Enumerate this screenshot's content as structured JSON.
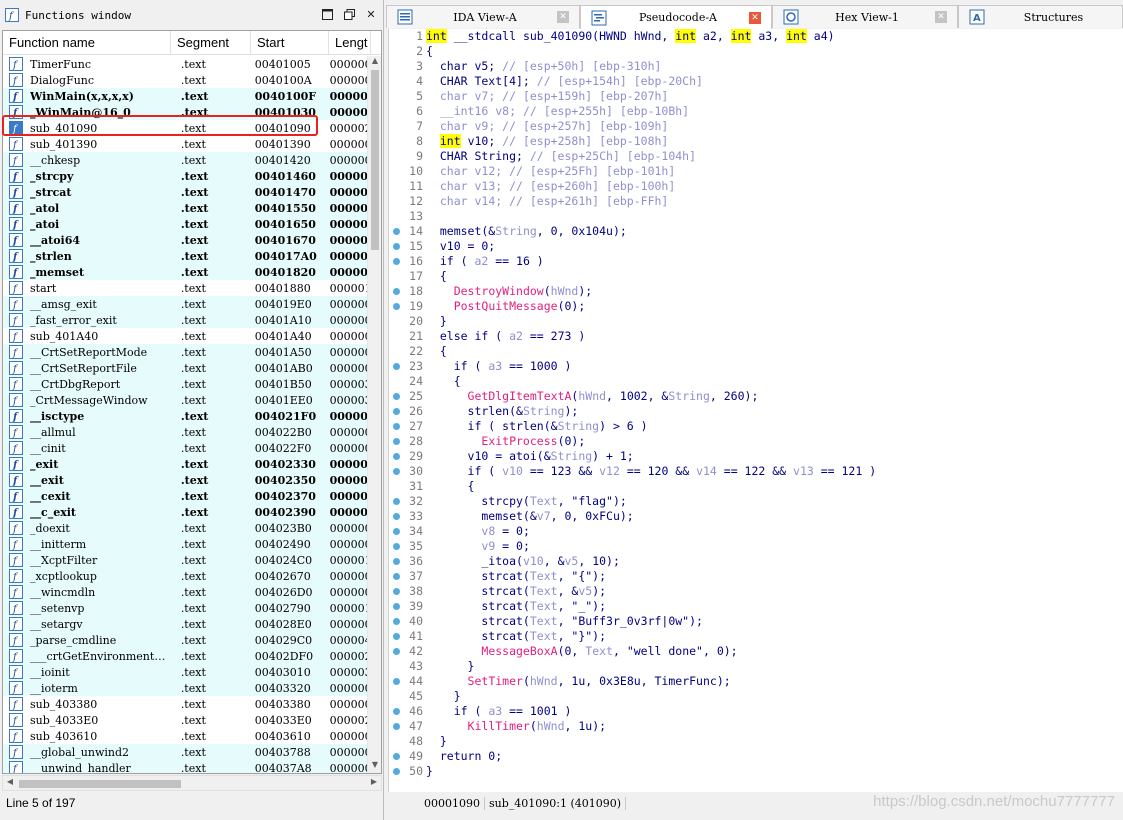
{
  "functions_window": {
    "title": "Functions window",
    "columns": [
      "Function name",
      "Segment",
      "Start",
      "Lengt"
    ],
    "status": "Line 5 of 197",
    "rows": [
      {
        "name": "TimerFunc",
        "seg": ".text",
        "start": "00401005",
        "len": "000000",
        "hl": false,
        "bold": false
      },
      {
        "name": "DialogFunc",
        "seg": ".text",
        "start": "0040100A",
        "len": "000000",
        "hl": false,
        "bold": false
      },
      {
        "name": "WinMain(x,x,x,x)",
        "seg": ".text",
        "start": "0040100F",
        "len": "000000",
        "hl": true,
        "bold": true
      },
      {
        "name": "_WinMain@16_0",
        "seg": ".text",
        "start": "00401030",
        "len": "000000",
        "hl": true,
        "bold": true
      },
      {
        "name": "sub_401090",
        "seg": ".text",
        "start": "00401090",
        "len": "000002",
        "hl": false,
        "bold": false
      },
      {
        "name": "sub_401390",
        "seg": ".text",
        "start": "00401390",
        "len": "000000",
        "hl": false,
        "bold": false
      },
      {
        "name": "__chkesp",
        "seg": ".text",
        "start": "00401420",
        "len": "000000",
        "hl": true,
        "bold": false
      },
      {
        "name": "_strcpy",
        "seg": ".text",
        "start": "00401460",
        "len": "000000",
        "hl": true,
        "bold": true
      },
      {
        "name": "_strcat",
        "seg": ".text",
        "start": "00401470",
        "len": "000000",
        "hl": true,
        "bold": true
      },
      {
        "name": "_atol",
        "seg": ".text",
        "start": "00401550",
        "len": "000000",
        "hl": true,
        "bold": true
      },
      {
        "name": "_atoi",
        "seg": ".text",
        "start": "00401650",
        "len": "000000",
        "hl": true,
        "bold": true
      },
      {
        "name": "__atoi64",
        "seg": ".text",
        "start": "00401670",
        "len": "000000",
        "hl": true,
        "bold": true
      },
      {
        "name": "_strlen",
        "seg": ".text",
        "start": "004017A0",
        "len": "000000",
        "hl": true,
        "bold": true
      },
      {
        "name": "_memset",
        "seg": ".text",
        "start": "00401820",
        "len": "000000",
        "hl": true,
        "bold": true
      },
      {
        "name": "start",
        "seg": ".text",
        "start": "00401880",
        "len": "000001",
        "hl": false,
        "bold": false
      },
      {
        "name": "__amsg_exit",
        "seg": ".text",
        "start": "004019E0",
        "len": "000000",
        "hl": true,
        "bold": false
      },
      {
        "name": "_fast_error_exit",
        "seg": ".text",
        "start": "00401A10",
        "len": "000000",
        "hl": true,
        "bold": false
      },
      {
        "name": "sub_401A40",
        "seg": ".text",
        "start": "00401A40",
        "len": "000000",
        "hl": false,
        "bold": false
      },
      {
        "name": "__CrtSetReportMode",
        "seg": ".text",
        "start": "00401A50",
        "len": "000000",
        "hl": true,
        "bold": false
      },
      {
        "name": "__CrtSetReportFile",
        "seg": ".text",
        "start": "00401AB0",
        "len": "000000",
        "hl": true,
        "bold": false
      },
      {
        "name": "__CrtDbgReport",
        "seg": ".text",
        "start": "00401B50",
        "len": "000003",
        "hl": true,
        "bold": false
      },
      {
        "name": "_CrtMessageWindow",
        "seg": ".text",
        "start": "00401EE0",
        "len": "000003",
        "hl": true,
        "bold": false
      },
      {
        "name": "__isctype",
        "seg": ".text",
        "start": "004021F0",
        "len": "000000",
        "hl": true,
        "bold": true
      },
      {
        "name": "__allmul",
        "seg": ".text",
        "start": "004022B0",
        "len": "000000",
        "hl": true,
        "bold": false
      },
      {
        "name": "__cinit",
        "seg": ".text",
        "start": "004022F0",
        "len": "000000",
        "hl": true,
        "bold": false
      },
      {
        "name": "_exit",
        "seg": ".text",
        "start": "00402330",
        "len": "000000",
        "hl": true,
        "bold": true
      },
      {
        "name": "__exit",
        "seg": ".text",
        "start": "00402350",
        "len": "000000",
        "hl": true,
        "bold": true
      },
      {
        "name": "__cexit",
        "seg": ".text",
        "start": "00402370",
        "len": "000000",
        "hl": true,
        "bold": true
      },
      {
        "name": "__c_exit",
        "seg": ".text",
        "start": "00402390",
        "len": "000000",
        "hl": true,
        "bold": true
      },
      {
        "name": "_doexit",
        "seg": ".text",
        "start": "004023B0",
        "len": "000000",
        "hl": true,
        "bold": false
      },
      {
        "name": "__initterm",
        "seg": ".text",
        "start": "00402490",
        "len": "000000",
        "hl": true,
        "bold": false
      },
      {
        "name": "__XcptFilter",
        "seg": ".text",
        "start": "004024C0",
        "len": "000001",
        "hl": true,
        "bold": false
      },
      {
        "name": "_xcptlookup",
        "seg": ".text",
        "start": "00402670",
        "len": "000000",
        "hl": true,
        "bold": false
      },
      {
        "name": "__wincmdln",
        "seg": ".text",
        "start": "004026D0",
        "len": "000000",
        "hl": true,
        "bold": false
      },
      {
        "name": "__setenvp",
        "seg": ".text",
        "start": "00402790",
        "len": "000001",
        "hl": true,
        "bold": false
      },
      {
        "name": "__setargv",
        "seg": ".text",
        "start": "004028E0",
        "len": "000000",
        "hl": true,
        "bold": false
      },
      {
        "name": "_parse_cmdline",
        "seg": ".text",
        "start": "004029C0",
        "len": "000004",
        "hl": true,
        "bold": false
      },
      {
        "name": "___crtGetEnvironment…",
        "seg": ".text",
        "start": "00402DF0",
        "len": "000002",
        "hl": true,
        "bold": false
      },
      {
        "name": "__ioinit",
        "seg": ".text",
        "start": "00403010",
        "len": "000003",
        "hl": true,
        "bold": false
      },
      {
        "name": "__ioterm",
        "seg": ".text",
        "start": "00403320",
        "len": "000000",
        "hl": true,
        "bold": false
      },
      {
        "name": "sub_403380",
        "seg": ".text",
        "start": "00403380",
        "len": "000000",
        "hl": false,
        "bold": false
      },
      {
        "name": "sub_4033E0",
        "seg": ".text",
        "start": "004033E0",
        "len": "000002",
        "hl": false,
        "bold": false
      },
      {
        "name": "sub_403610",
        "seg": ".text",
        "start": "00403610",
        "len": "000000",
        "hl": false,
        "bold": false
      },
      {
        "name": "__global_unwind2",
        "seg": ".text",
        "start": "00403788",
        "len": "000000",
        "hl": true,
        "bold": false
      },
      {
        "name": "__unwind_handler",
        "seg": ".text",
        "start": "004037A8",
        "len": "000000",
        "hl": true,
        "bold": false
      }
    ]
  },
  "tabs": [
    {
      "label": "IDA View-A",
      "icon": "ida-view-icon",
      "active": false
    },
    {
      "label": "Pseudocode-A",
      "icon": "pseudocode-icon",
      "active": true
    },
    {
      "label": "Hex View-1",
      "icon": "hex-view-icon",
      "active": false
    },
    {
      "label": "Structures",
      "icon": "structures-icon",
      "active": false
    }
  ],
  "code": [
    {
      "n": "1",
      "dot": false,
      "html": "<span class=\"kw\">int</span> __stdcall sub_401090(HWND hWnd, <span class=\"kw\">int</span> a2, <span class=\"kw\">int</span> a3, <span class=\"kw\">int</span> a4)"
    },
    {
      "n": "2",
      "dot": false,
      "html": "{"
    },
    {
      "n": "3",
      "dot": false,
      "html": "  char v5; <span class=\"cm\">// [esp+50h] [ebp-310h]</span>"
    },
    {
      "n": "4",
      "dot": false,
      "html": "  CHAR Text[4]; <span class=\"cm\">// [esp+154h] [ebp-20Ch]</span>"
    },
    {
      "n": "5",
      "dot": false,
      "html": "  <span class=\"cm\">char v7; // [esp+159h] [ebp-207h]</span>"
    },
    {
      "n": "6",
      "dot": false,
      "html": "  <span class=\"cm\">__int16 v8; // [esp+255h] [ebp-10Bh]</span>"
    },
    {
      "n": "7",
      "dot": false,
      "html": "  <span class=\"cm\">char v9; // [esp+257h] [ebp-109h]</span>"
    },
    {
      "n": "8",
      "dot": false,
      "html": "  <span class=\"kw\">int</span> v10; <span class=\"cm\">// [esp+258h] [ebp-108h]</span>"
    },
    {
      "n": "9",
      "dot": false,
      "html": "  CHAR String; <span class=\"cm\">// [esp+25Ch] [ebp-104h]</span>"
    },
    {
      "n": "10",
      "dot": false,
      "html": "  <span class=\"cm\">char v12; // [esp+25Fh] [ebp-101h]</span>"
    },
    {
      "n": "11",
      "dot": false,
      "html": "  <span class=\"cm\">char v13; // [esp+260h] [ebp-100h]</span>"
    },
    {
      "n": "12",
      "dot": false,
      "html": "  <span class=\"cm\">char v14; // [esp+261h] [ebp-FFh]</span>"
    },
    {
      "n": "13",
      "dot": false,
      "html": ""
    },
    {
      "n": "14",
      "dot": true,
      "html": "  memset(&amp;<span class=\"ar\">String</span>, 0, 0x104u);"
    },
    {
      "n": "15",
      "dot": true,
      "html": "  v10 = 0;"
    },
    {
      "n": "16",
      "dot": true,
      "html": "  if ( <span class=\"ar\">a2</span> == 16 )"
    },
    {
      "n": "17",
      "dot": false,
      "html": "  {"
    },
    {
      "n": "18",
      "dot": true,
      "html": "    <span class=\"fnc\">DestroyWindow</span>(<span class=\"ar\">hWnd</span>);"
    },
    {
      "n": "19",
      "dot": true,
      "html": "    <span class=\"fnc\">PostQuitMessage</span>(0);"
    },
    {
      "n": "20",
      "dot": false,
      "html": "  }"
    },
    {
      "n": "21",
      "dot": false,
      "html": "  else if ( <span class=\"ar\">a2</span> == 273 )"
    },
    {
      "n": "22",
      "dot": false,
      "html": "  {"
    },
    {
      "n": "23",
      "dot": true,
      "html": "    if ( <span class=\"ar\">a3</span> == 1000 )"
    },
    {
      "n": "24",
      "dot": false,
      "html": "    {"
    },
    {
      "n": "25",
      "dot": true,
      "html": "      <span class=\"fnc\">GetDlgItemTextA</span>(<span class=\"ar\">hWnd</span>, 1002, &amp;<span class=\"ar\">String</span>, 260);"
    },
    {
      "n": "26",
      "dot": true,
      "html": "      strlen(&amp;<span class=\"ar\">String</span>);"
    },
    {
      "n": "27",
      "dot": true,
      "html": "      if ( strlen(&amp;<span class=\"ar\">String</span>) &gt; 6 )"
    },
    {
      "n": "28",
      "dot": true,
      "html": "        <span class=\"fnc\">ExitProcess</span>(0);"
    },
    {
      "n": "29",
      "dot": true,
      "html": "      v10 = atoi(&amp;<span class=\"ar\">String</span>) + 1;"
    },
    {
      "n": "30",
      "dot": true,
      "html": "      if ( <span class=\"ar\">v10</span> == 123 &amp;&amp; <span class=\"ar\">v12</span> == 120 &amp;&amp; <span class=\"ar\">v14</span> == 122 &amp;&amp; <span class=\"ar\">v13</span> == 121 )"
    },
    {
      "n": "31",
      "dot": false,
      "html": "      {"
    },
    {
      "n": "32",
      "dot": true,
      "html": "        strcpy(<span class=\"ar\">Text</span>, \"flag\");"
    },
    {
      "n": "33",
      "dot": true,
      "html": "        memset(&amp;<span class=\"ar\">v7</span>, 0, 0xFCu);"
    },
    {
      "n": "34",
      "dot": true,
      "html": "        <span class=\"ar\">v8</span> = 0;"
    },
    {
      "n": "35",
      "dot": true,
      "html": "        <span class=\"ar\">v9</span> = 0;"
    },
    {
      "n": "36",
      "dot": true,
      "html": "        _itoa(<span class=\"ar\">v10</span>, &amp;<span class=\"ar\">v5</span>, 10);"
    },
    {
      "n": "37",
      "dot": true,
      "html": "        strcat(<span class=\"ar\">Text</span>, \"{\");"
    },
    {
      "n": "38",
      "dot": true,
      "html": "        strcat(<span class=\"ar\">Text</span>, &amp;<span class=\"ar\">v5</span>);"
    },
    {
      "n": "39",
      "dot": true,
      "html": "        strcat(<span class=\"ar\">Text</span>, \"_\");"
    },
    {
      "n": "40",
      "dot": true,
      "html": "        strcat(<span class=\"ar\">Text</span>, \"Buff3r_0v3rf|0w\");"
    },
    {
      "n": "41",
      "dot": true,
      "html": "        strcat(<span class=\"ar\">Text</span>, \"}\");"
    },
    {
      "n": "42",
      "dot": true,
      "html": "        <span class=\"fnc\">MessageBoxA</span>(0, <span class=\"ar\">Text</span>, \"well done\", 0);"
    },
    {
      "n": "43",
      "dot": false,
      "html": "      }"
    },
    {
      "n": "44",
      "dot": true,
      "html": "      <span class=\"fnc\">SetTimer</span>(<span class=\"ar\">hWnd</span>, 1u, 0x3E8u, TimerFunc);"
    },
    {
      "n": "45",
      "dot": false,
      "html": "    }"
    },
    {
      "n": "46",
      "dot": true,
      "html": "    if ( <span class=\"ar\">a3</span> == 1001 )"
    },
    {
      "n": "47",
      "dot": true,
      "html": "      <span class=\"fnc\">KillTimer</span>(<span class=\"ar\">hWnd</span>, 1u);"
    },
    {
      "n": "48",
      "dot": false,
      "html": "  }"
    },
    {
      "n": "49",
      "dot": true,
      "html": "  return 0;"
    },
    {
      "n": "50",
      "dot": true,
      "html": "}"
    }
  ],
  "code_status": {
    "addr": "00001090",
    "loc": "sub_401090:1 (401090)"
  },
  "watermark": "https://blog.csdn.net/mochu7777777"
}
